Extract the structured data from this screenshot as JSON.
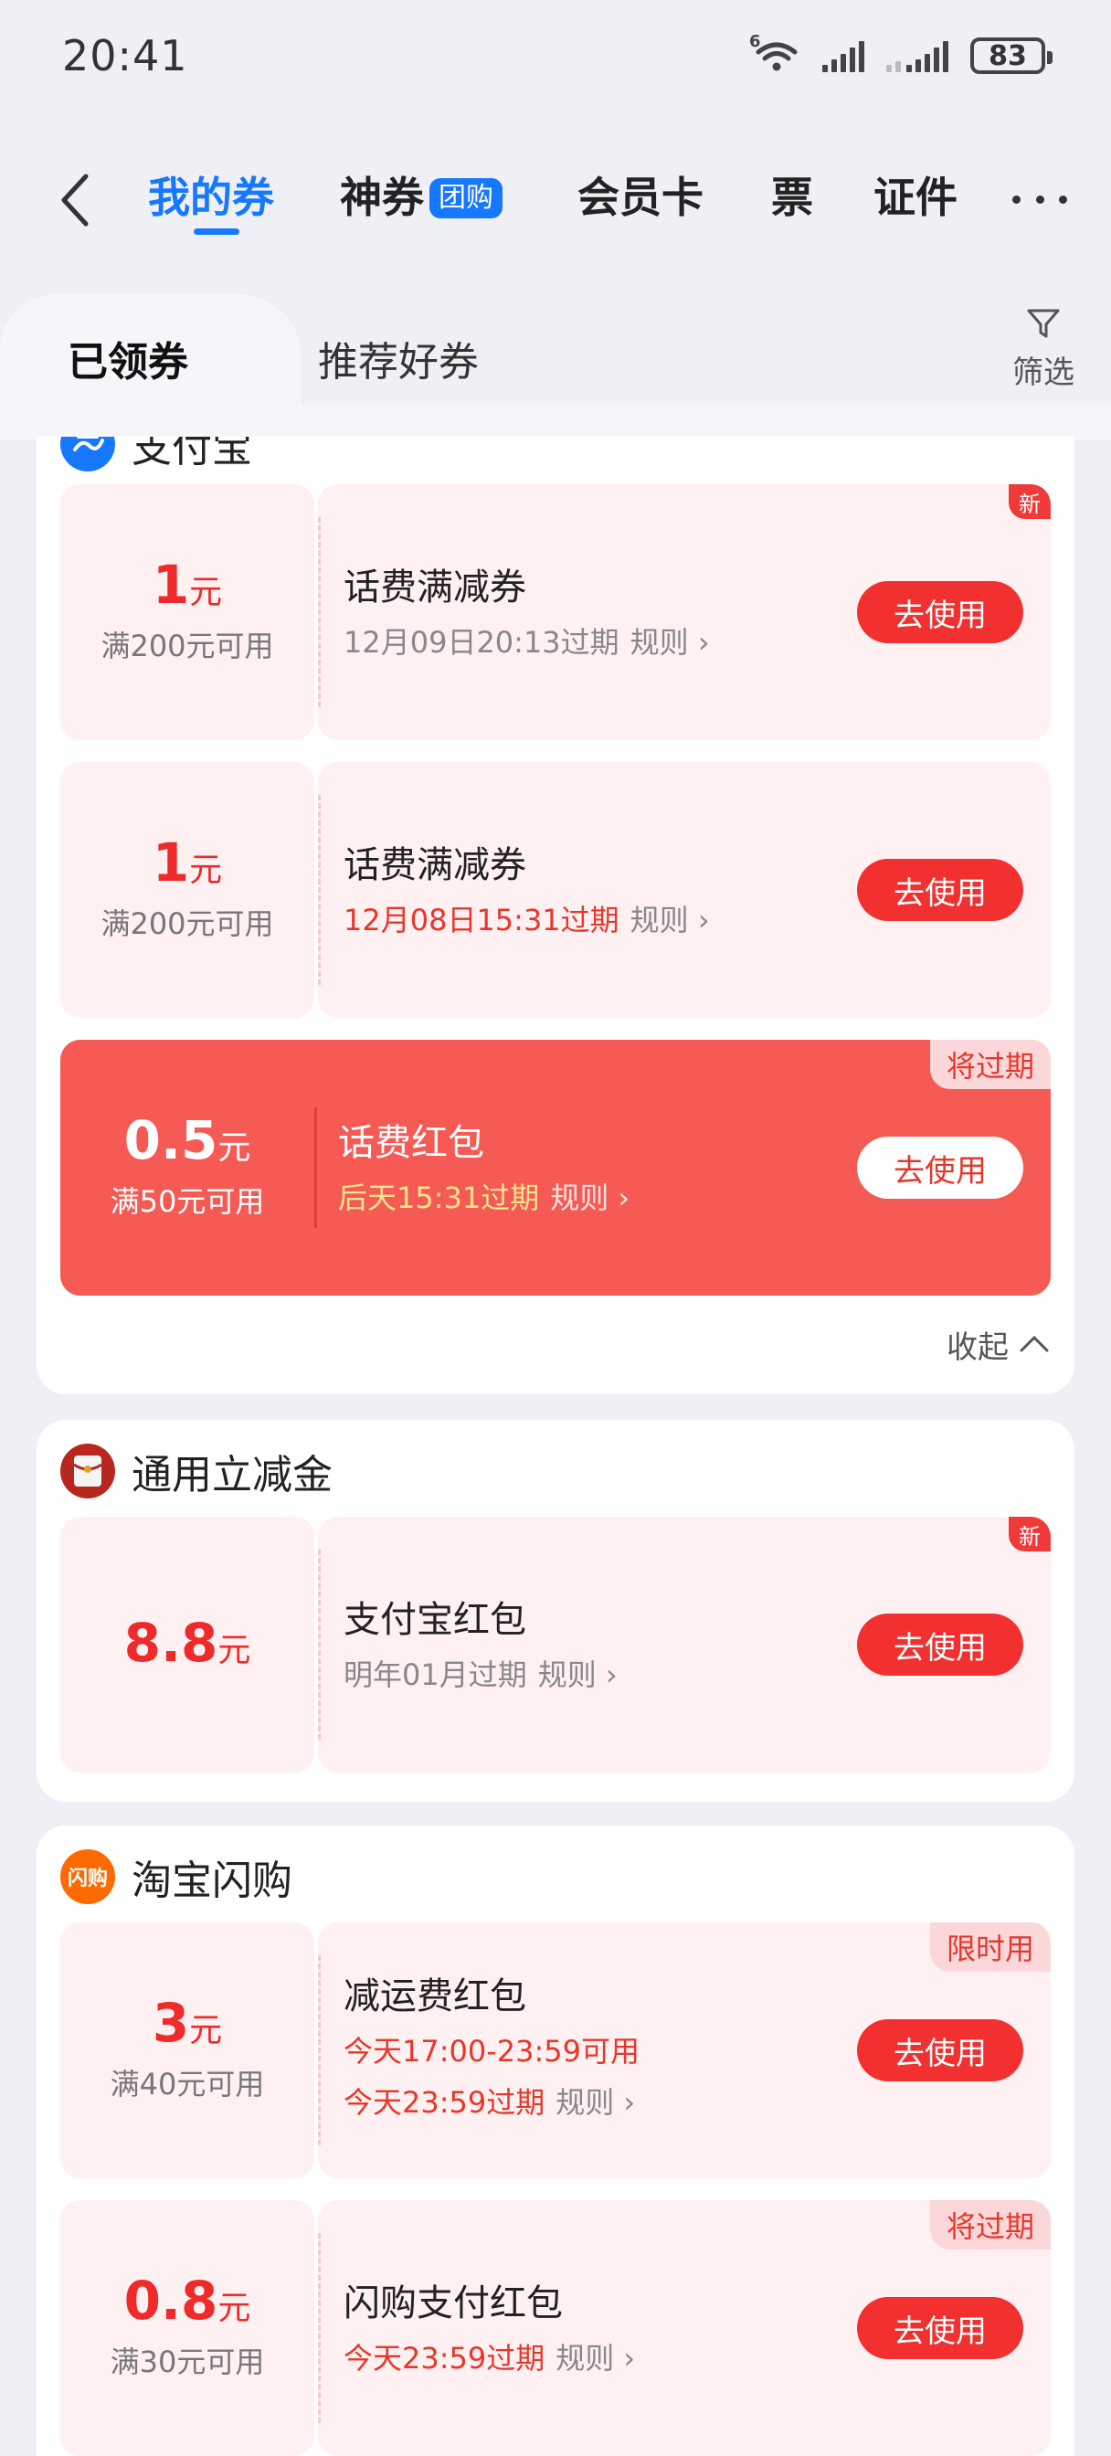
{
  "status_bar": {
    "time": "20:41",
    "net_label": "6",
    "battery": "83"
  },
  "nav": {
    "tabs": [
      {
        "label": "我的券"
      },
      {
        "label": "神券",
        "badge": "团购"
      },
      {
        "label": "会员卡"
      },
      {
        "label": "票"
      },
      {
        "label": "证件"
      }
    ]
  },
  "segments": {
    "claimed": "已领券",
    "recommended": "推荐好券",
    "filter": "筛选"
  },
  "sections": [
    {
      "title": "支付宝",
      "collapse": "收起",
      "coupons": [
        {
          "amount": "1",
          "unit": "元",
          "condition": "满200元可用",
          "title": "话费满减券",
          "expire": "12月09日20:13过期",
          "rule": "规则",
          "button": "去使用",
          "tag": "新"
        },
        {
          "amount": "1",
          "unit": "元",
          "condition": "满200元可用",
          "title": "话费满减券",
          "expire": "12月08日15:31过期",
          "rule": "规则",
          "button": "去使用"
        },
        {
          "amount": "0.5",
          "unit": "元",
          "condition": "满50元可用",
          "title": "话费红包",
          "expire": "后天15:31过期",
          "rule": "规则",
          "button": "去使用",
          "tag": "将过期"
        }
      ]
    },
    {
      "title": "通用立减金",
      "coupons": [
        {
          "amount": "8.8",
          "unit": "元",
          "title": "支付宝红包",
          "expire": "明年01月过期",
          "rule": "规则",
          "button": "去使用",
          "tag": "新"
        }
      ]
    },
    {
      "title": "淘宝闪购",
      "icon_text": "闪购",
      "coupons": [
        {
          "amount": "3",
          "unit": "元",
          "condition": "满40元可用",
          "title": "减运费红包",
          "usable": "今天17:00-23:59可用",
          "expire": "今天23:59过期",
          "rule": "规则",
          "button": "去使用",
          "tag": "限时用"
        },
        {
          "amount": "0.8",
          "unit": "元",
          "condition": "满30元可用",
          "title": "闪购支付红包",
          "expire": "今天23:59过期",
          "rule": "规则",
          "button": "去使用",
          "tag": "将过期"
        }
      ]
    }
  ],
  "colors": {
    "accent": "#1677ff",
    "red": "#f23030",
    "hot": "#f55a55",
    "coupon_bg": "#fff0f1"
  }
}
